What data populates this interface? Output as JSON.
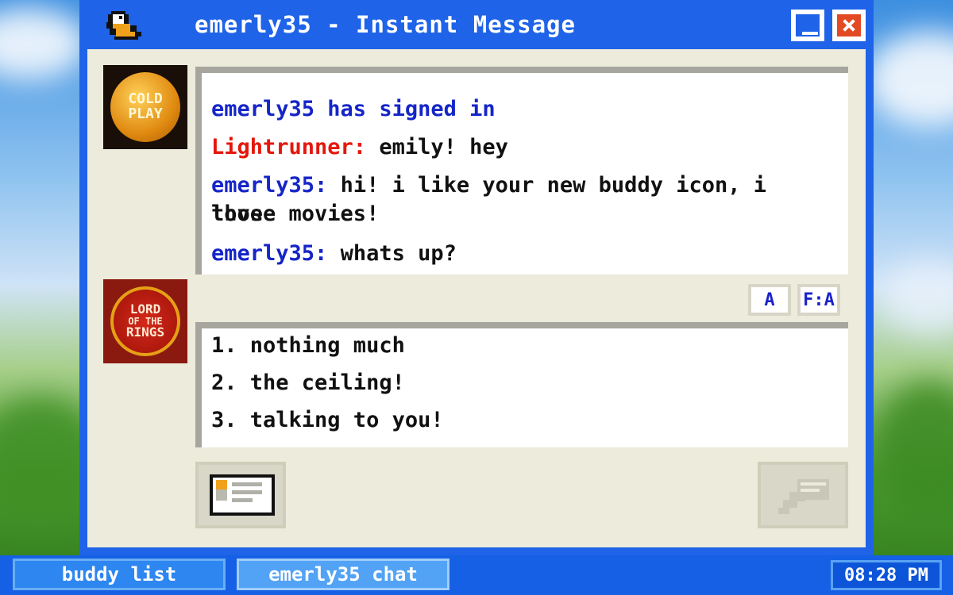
{
  "window": {
    "title": "emerly35 - Instant Message",
    "icons": {
      "app": "duck-messenger-icon",
      "minimize": "minimize-icon",
      "close": "close-icon"
    },
    "colors": {
      "titlebar": "#1f63e8",
      "close": "#e24a24",
      "panel": "#ecebdc"
    }
  },
  "buddy_icon": {
    "line1": "COLD",
    "line2": "PLAY"
  },
  "my_icon": {
    "line1": "LORD",
    "line2": "OF THE",
    "line3": "RINGS"
  },
  "log": {
    "system": "emerly35 has signed in",
    "messages": [
      {
        "name": "Lightrunner:",
        "text": " emily! hey"
      },
      {
        "name": "emerly35:",
        "text": " hi! i like your new buddy icon, i love",
        "text_cont": "those movies!"
      },
      {
        "name": "emerly35:",
        "text": " whats up?"
      }
    ]
  },
  "format": {
    "a_label": "A",
    "font_label": "F:A",
    "icons": [
      "text-color-icon",
      "font-icon"
    ]
  },
  "compose": {
    "options": [
      "1. nothing much",
      "2. the ceiling!",
      "3. talking to you!"
    ]
  },
  "buttons": {
    "profile_icon": "profile-card-icon",
    "send_icon": "send-icon"
  },
  "taskbar": {
    "buddy_list": "buddy list",
    "chat": "emerly35 chat",
    "clock": "08:28 PM"
  }
}
